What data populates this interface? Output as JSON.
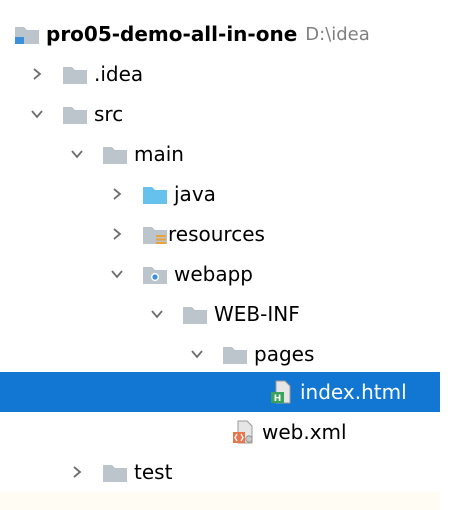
{
  "project": {
    "name": "pro05-demo-all-in-one",
    "path": "D:\\idea"
  },
  "tree": {
    "idea": ".idea",
    "src": "src",
    "main": "main",
    "java": "java",
    "resources": "resources",
    "webapp": "webapp",
    "webinf": "WEB-INF",
    "pages": "pages",
    "index": "index.html",
    "webxml": "web.xml",
    "test": "test"
  },
  "colors": {
    "selection": "#1177d3",
    "folder": "#bcc4cc",
    "source_folder": "#66c1ec",
    "html_badge": "#3aa35b",
    "xml_badge": "#e8754d"
  }
}
